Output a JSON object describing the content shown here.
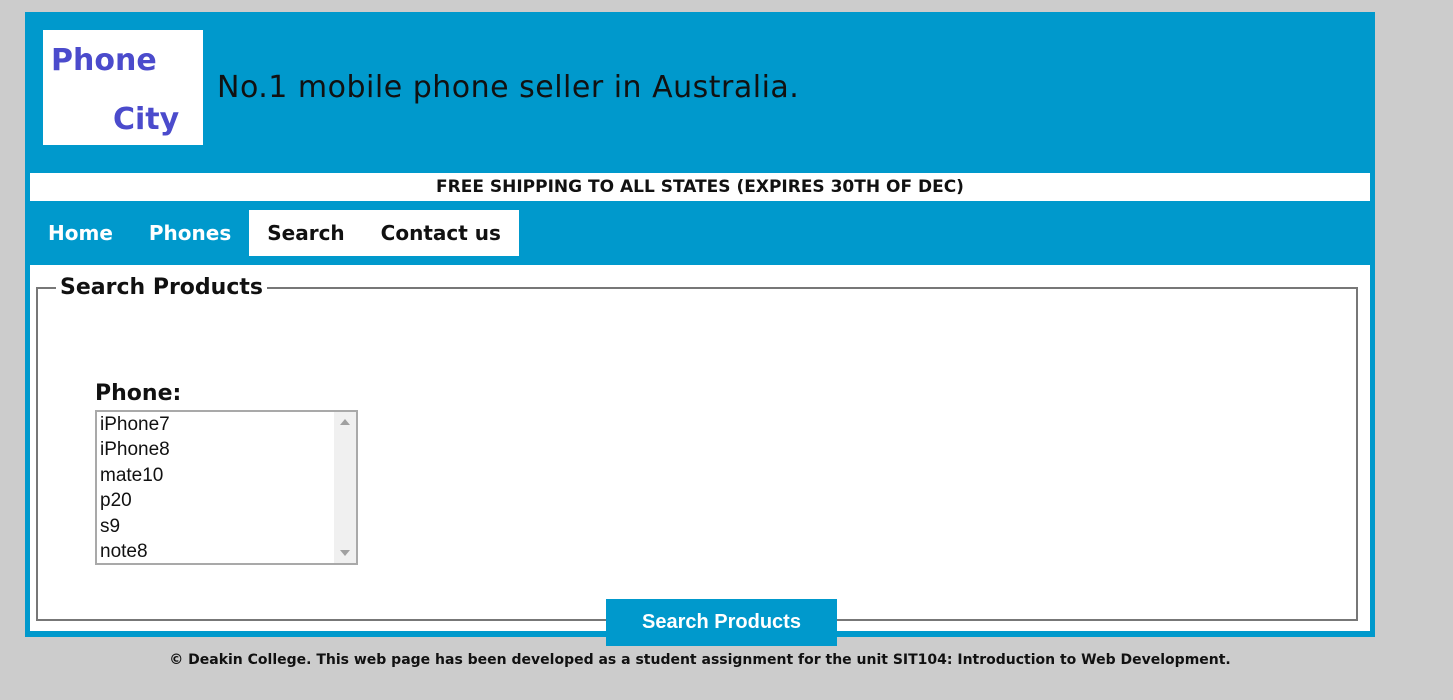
{
  "header": {
    "logo": {
      "line1": "Phone",
      "line2": "City",
      "text_color": "#4b4bcc"
    },
    "tagline": "No.1 mobile phone seller in Australia."
  },
  "banner": "FREE SHIPPING TO ALL STATES (EXPIRES 30TH OF DEC)",
  "nav": {
    "items": [
      {
        "label": "Home"
      },
      {
        "label": "Phones"
      },
      {
        "label": "Search"
      },
      {
        "label": "Contact us"
      }
    ]
  },
  "search": {
    "legend": "Search Products",
    "phone_label": "Phone:",
    "options": [
      "iPhone7",
      "iPhone8",
      "mate10",
      "p20",
      "s9",
      "note8"
    ],
    "button_label": "Search Products"
  },
  "footer": "© Deakin College. This web page has been developed as a student assignment for the unit SIT104: Introduction to Web Development.",
  "colors": {
    "page_bg": "#cccccc",
    "brand_blue": "#0099cc",
    "white": "#ffffff",
    "text": "#111111"
  },
  "icons": {
    "scroll_up": "triangle-up-icon",
    "scroll_down": "triangle-down-icon"
  }
}
